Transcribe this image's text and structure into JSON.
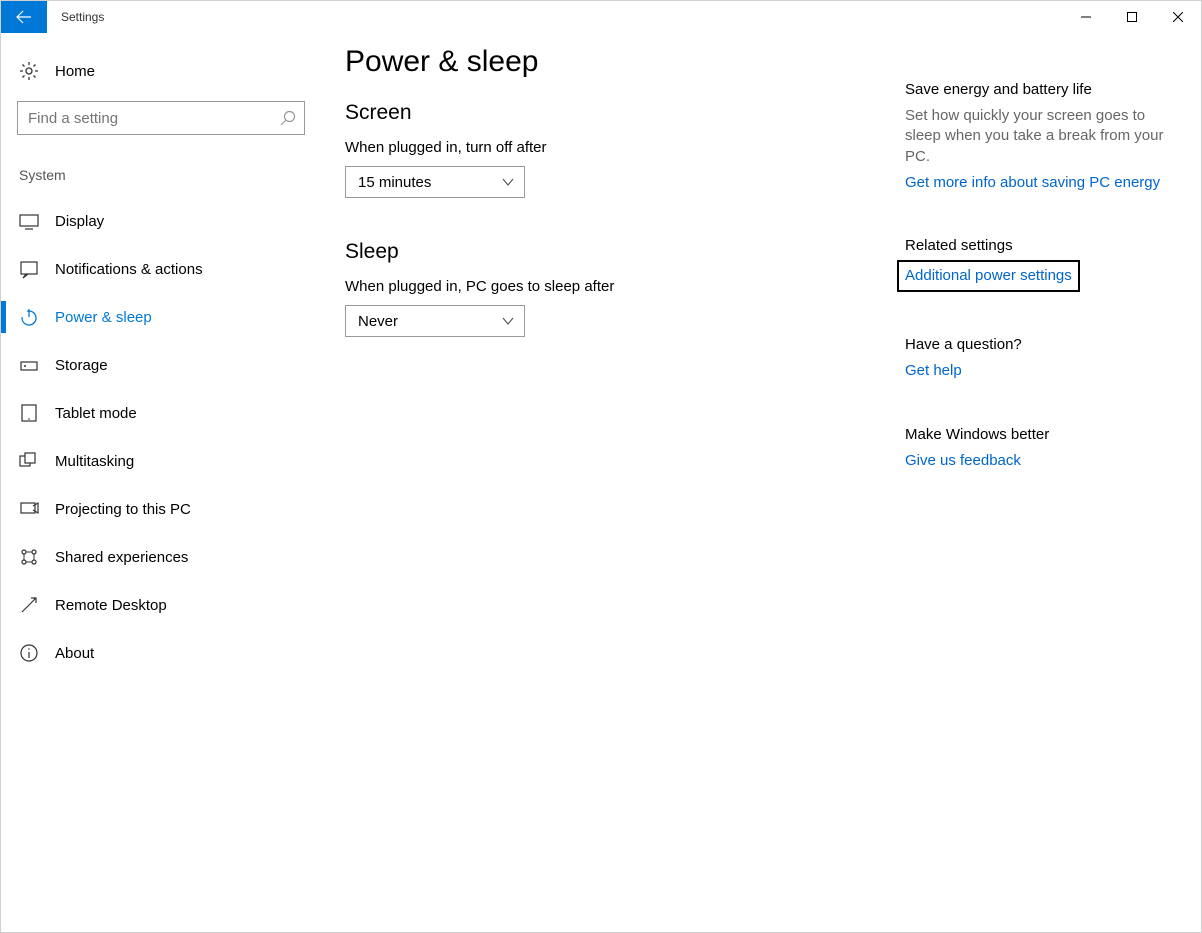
{
  "window": {
    "title": "Settings"
  },
  "sidebar": {
    "home": "Home",
    "search_placeholder": "Find a setting",
    "section": "System",
    "items": [
      {
        "label": "Display"
      },
      {
        "label": "Notifications & actions"
      },
      {
        "label": "Power & sleep"
      },
      {
        "label": "Storage"
      },
      {
        "label": "Tablet mode"
      },
      {
        "label": "Multitasking"
      },
      {
        "label": "Projecting to this PC"
      },
      {
        "label": "Shared experiences"
      },
      {
        "label": "Remote Desktop"
      },
      {
        "label": "About"
      }
    ]
  },
  "main": {
    "title": "Power & sleep",
    "screen": {
      "heading": "Screen",
      "label": "When plugged in, turn off after",
      "value": "15 minutes"
    },
    "sleep": {
      "heading": "Sleep",
      "label": "When plugged in, PC goes to sleep after",
      "value": "Never"
    }
  },
  "rail": {
    "energy": {
      "heading": "Save energy and battery life",
      "text": "Set how quickly your screen goes to sleep when you take a break from your PC.",
      "link": "Get more info about saving PC energy"
    },
    "related": {
      "heading": "Related settings",
      "link": "Additional power settings"
    },
    "help": {
      "heading": "Have a question?",
      "link": "Get help"
    },
    "feedback": {
      "heading": "Make Windows better",
      "link": "Give us feedback"
    }
  }
}
